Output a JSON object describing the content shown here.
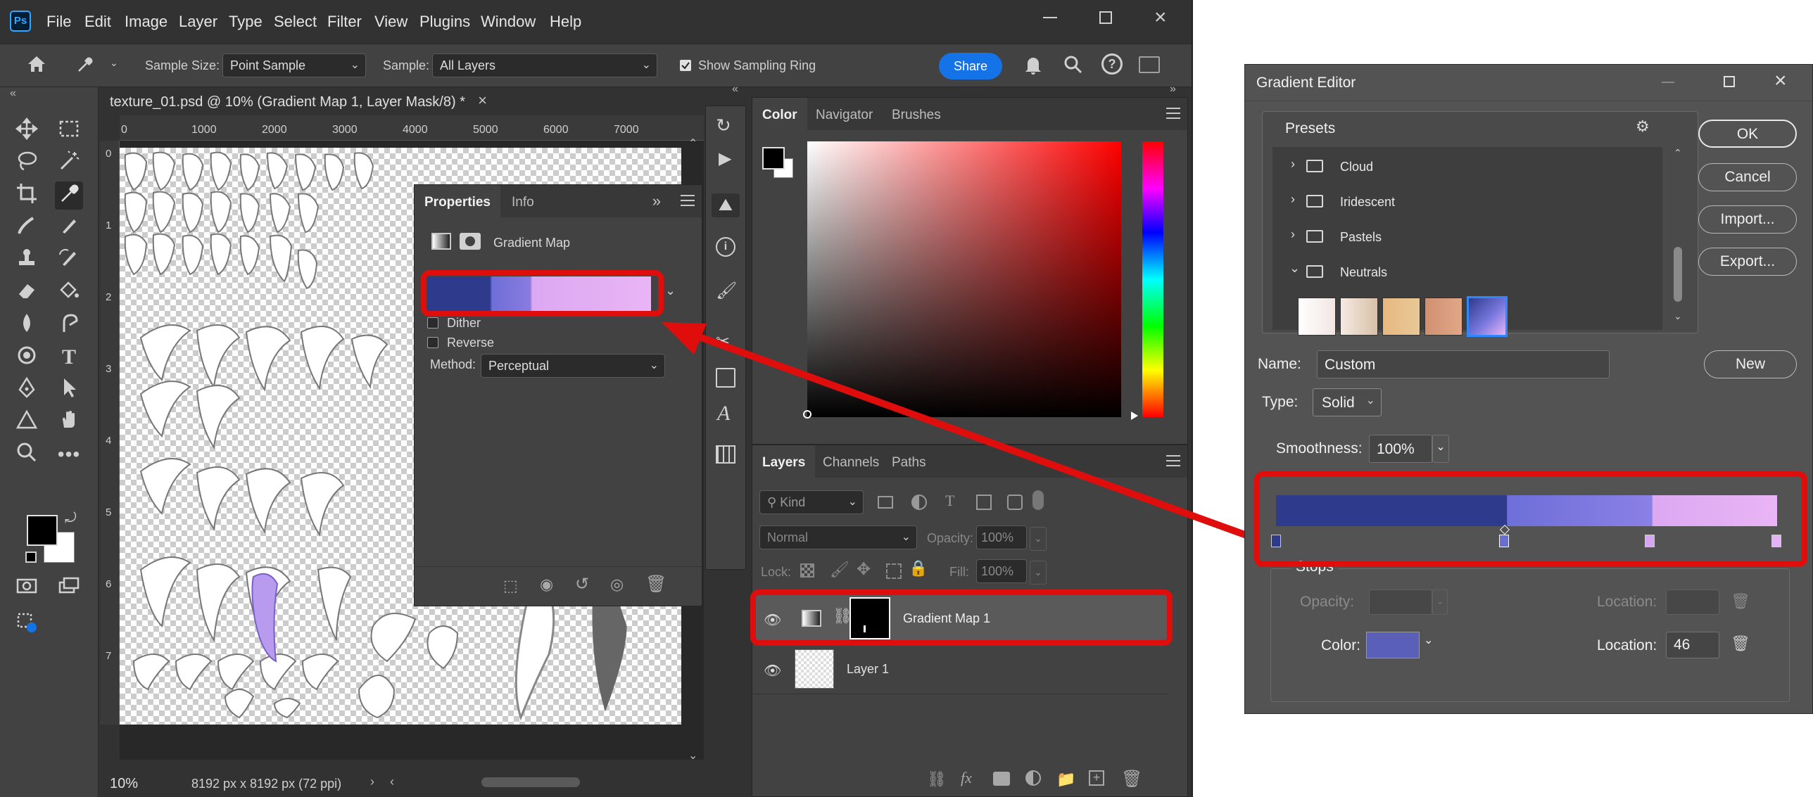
{
  "app": {
    "logo": "Ps",
    "menu": [
      "File",
      "Edit",
      "Image",
      "Layer",
      "Type",
      "Select",
      "Filter",
      "View",
      "Plugins",
      "Window",
      "Help"
    ]
  },
  "options_bar": {
    "sample_size_label": "Sample Size:",
    "sample_size_value": "Point Sample",
    "sample_label": "Sample:",
    "sample_value": "All Layers",
    "show_ring_label": "Show Sampling Ring",
    "share_label": "Share"
  },
  "document": {
    "tab_title": "texture_01.psd @ 10% (Gradient Map 1, Layer Mask/8) *",
    "ruler_labels": [
      "0",
      "1000",
      "2000",
      "3000",
      "4000",
      "5000",
      "6000",
      "7000"
    ],
    "ruler_v_labels": [
      "0",
      "1",
      "2",
      "3",
      "4",
      "5",
      "6",
      "7"
    ],
    "zoom": "10%",
    "doc_info": "8192 px x 8192 px (72 ppi)"
  },
  "properties_panel": {
    "tabs": [
      "Properties",
      "Info"
    ],
    "type_label": "Gradient Map",
    "dither_label": "Dither",
    "reverse_label": "Reverse",
    "method_label": "Method:",
    "method_value": "Perceptual"
  },
  "color_panel": {
    "tabs": [
      "Color",
      "Navigator",
      "Brushes"
    ]
  },
  "layers_panel": {
    "tabs": [
      "Layers",
      "Channels",
      "Paths"
    ],
    "kind_placeholder": "Kind",
    "blend_mode": "Normal",
    "opacity_label": "Opacity:",
    "opacity_value": "100%",
    "lock_label": "Lock:",
    "fill_label": "Fill:",
    "fill_value": "100%",
    "layers": [
      {
        "name": "Gradient Map 1"
      },
      {
        "name": "Layer 1"
      }
    ]
  },
  "gradient_editor": {
    "title": "Gradient Editor",
    "presets_label": "Presets",
    "preset_folders": [
      "Cloud",
      "Iridescent",
      "Pastels",
      "Neutrals"
    ],
    "buttons": {
      "ok": "OK",
      "cancel": "Cancel",
      "import": "Import...",
      "export": "Export...",
      "new": "New"
    },
    "name_label": "Name:",
    "name_value": "Custom",
    "type_label": "Type:",
    "type_value": "Solid",
    "smoothness_label": "Smoothness:",
    "smoothness_value": "100%",
    "stops_label": "Stops",
    "opacity_label": "Opacity:",
    "location_label": "Location:",
    "color_label": "Color:",
    "location_value": "46",
    "stops": [
      {
        "location": 0,
        "color": "#2e3a8c"
      },
      {
        "location": 46,
        "color": "#6a6ed2"
      },
      {
        "location": 75,
        "color": "#d7a6f0"
      },
      {
        "location": 100,
        "color": "#e4b3f5"
      }
    ]
  },
  "colors": {
    "gradient_start": "#2e3a8c",
    "gradient_mid": "#7777dd",
    "gradient_end": "#e9b5f5",
    "highlight": "#e00d0d",
    "accent": "#1473e6"
  }
}
